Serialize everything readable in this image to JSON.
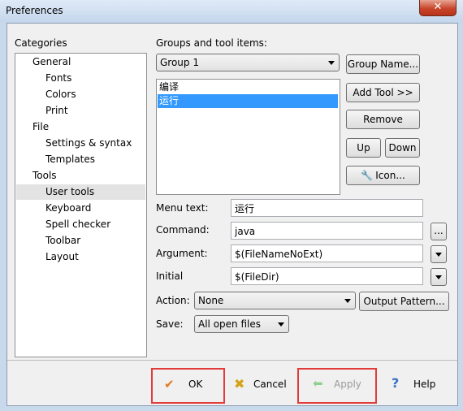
{
  "window": {
    "title": "Preferences",
    "close_glyph": "✕"
  },
  "categories": {
    "heading": "Categories",
    "items": [
      {
        "label": "General"
      },
      {
        "label": "Fonts"
      },
      {
        "label": "Colors"
      },
      {
        "label": "Print"
      },
      {
        "label": "File"
      },
      {
        "label": "Settings & syntax"
      },
      {
        "label": "Templates"
      },
      {
        "label": "Tools"
      },
      {
        "label": "User tools",
        "selected": true
      },
      {
        "label": "Keyboard"
      },
      {
        "label": "Spell checker"
      },
      {
        "label": "Toolbar"
      },
      {
        "label": "Layout"
      }
    ]
  },
  "groups": {
    "heading": "Groups and tool items:",
    "selected_group": "Group 1",
    "tool_items": [
      "编译",
      "运行"
    ],
    "selected_tool": "运行"
  },
  "buttons": {
    "group_name": "Group Name...",
    "add_tool": "Add Tool >>",
    "remove": "Remove",
    "up": "Up",
    "down": "Down",
    "icon": "Icon...",
    "ellipsis": "...",
    "output_pattern": "Output Pattern...",
    "ok": "OK",
    "cancel": "Cancel",
    "apply": "Apply",
    "help": "Help"
  },
  "form": {
    "menu_text_label": "Menu text:",
    "menu_text_value": "运行",
    "command_label": "Command:",
    "command_value": "java",
    "argument_label": "Argument:",
    "argument_value": "$(FileNameNoExt)",
    "initial_label": "Initial",
    "initial_value": "$(FileDir)",
    "action_label": "Action:",
    "action_value": "None",
    "save_label": "Save:",
    "save_value": "All open files"
  },
  "colors": {
    "highlight_box": "#e33b3b",
    "selection": "#3399ff"
  }
}
